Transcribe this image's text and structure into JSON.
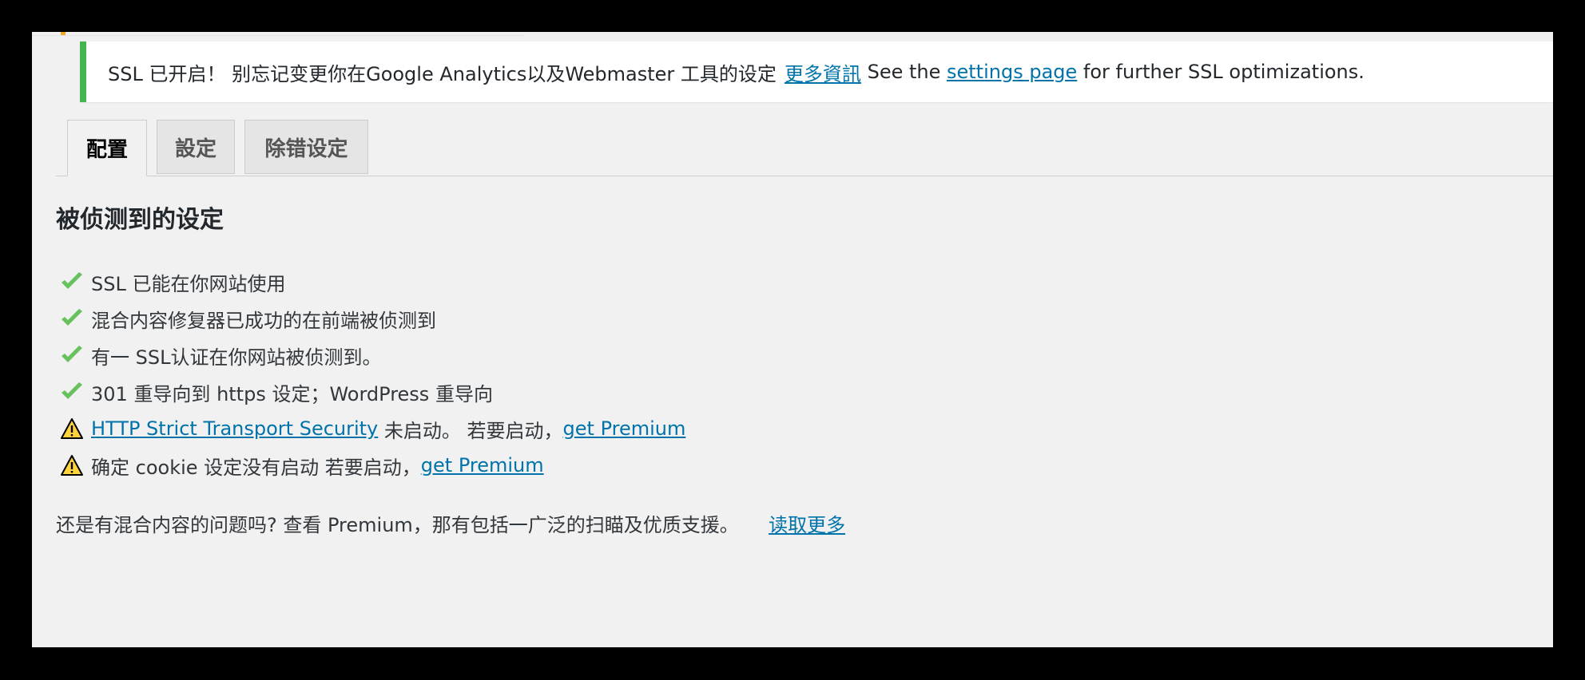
{
  "notice": {
    "text": "SSL 已开启！ 别忘记变更你在Google Analytics以及Webmaster 工具的设定",
    "more_link": "更多資訊",
    "see_the": "See the",
    "settings_link": "settings page",
    "tail": "for further SSL optimizations."
  },
  "tabs": [
    {
      "label": "配置",
      "active": true
    },
    {
      "label": "設定",
      "active": false
    },
    {
      "label": "除错设定",
      "active": false
    }
  ],
  "section_title": "被侦测到的设定",
  "status_items": [
    {
      "icon": "check-icon",
      "text": "SSL 已能在你网站使用"
    },
    {
      "icon": "check-icon",
      "text": "混合内容修复器已成功的在前端被侦测到"
    },
    {
      "icon": "check-icon",
      "text": "有一 SSL认证在你网站被侦测到。"
    },
    {
      "icon": "check-icon",
      "text": "301 重导向到 https 设定；WordPress 重导向"
    },
    {
      "icon": "warning-icon",
      "link": "HTTP Strict Transport Security",
      "text": "未启动。 若要启动，",
      "premium": "get Premium"
    },
    {
      "icon": "warning-icon",
      "text": "确定 cookie 设定没有启动 若要启动，",
      "premium": "get Premium"
    }
  ],
  "footer": {
    "text": "还是有混合内容的问题吗? 查看 Premium，那有包括一广泛的扫瞄及优质支援。",
    "read_more": "读取更多"
  },
  "colors": {
    "success": "#46b450",
    "check": "#67c25e",
    "warning": "#ffd33c",
    "link": "#0073aa",
    "accent": "#f1a82a"
  }
}
